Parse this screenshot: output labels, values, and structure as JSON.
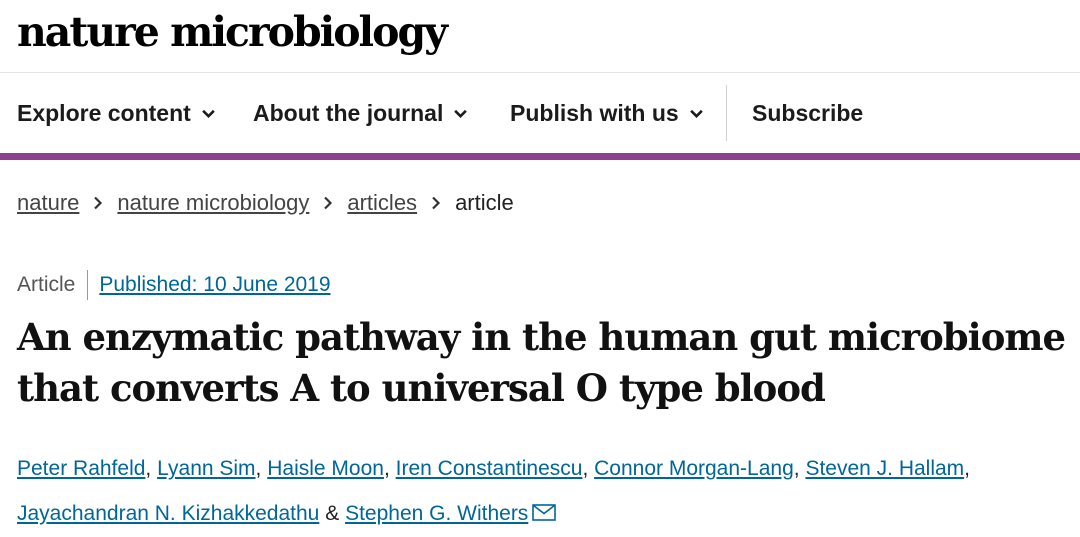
{
  "header": {
    "logo_text": "nature microbiology"
  },
  "nav": {
    "items": [
      {
        "label": "Explore content",
        "has_dropdown": true
      },
      {
        "label": "About the journal",
        "has_dropdown": true
      },
      {
        "label": "Publish with us",
        "has_dropdown": true
      },
      {
        "label": "Subscribe",
        "has_dropdown": false
      }
    ],
    "accent_color": "#8e3f8f"
  },
  "breadcrumb": {
    "items": [
      "nature",
      "nature microbiology",
      "articles"
    ],
    "current": "article"
  },
  "article": {
    "type": "Article",
    "published": "Published: 10 June 2019",
    "title": "An enzymatic pathway in the human gut microbiome that converts A to universal O type blood",
    "authors": [
      "Peter Rahfeld",
      "Lyann Sim",
      "Haisle Moon",
      "Iren Constantinescu",
      "Connor Morgan-Lang",
      "Steven J. Hallam",
      "Jayachandran N. Kizhakkedathu",
      "Stephen G. Withers"
    ],
    "author_separator": ",",
    "author_last_separator": "&",
    "link_color": "#006699"
  }
}
